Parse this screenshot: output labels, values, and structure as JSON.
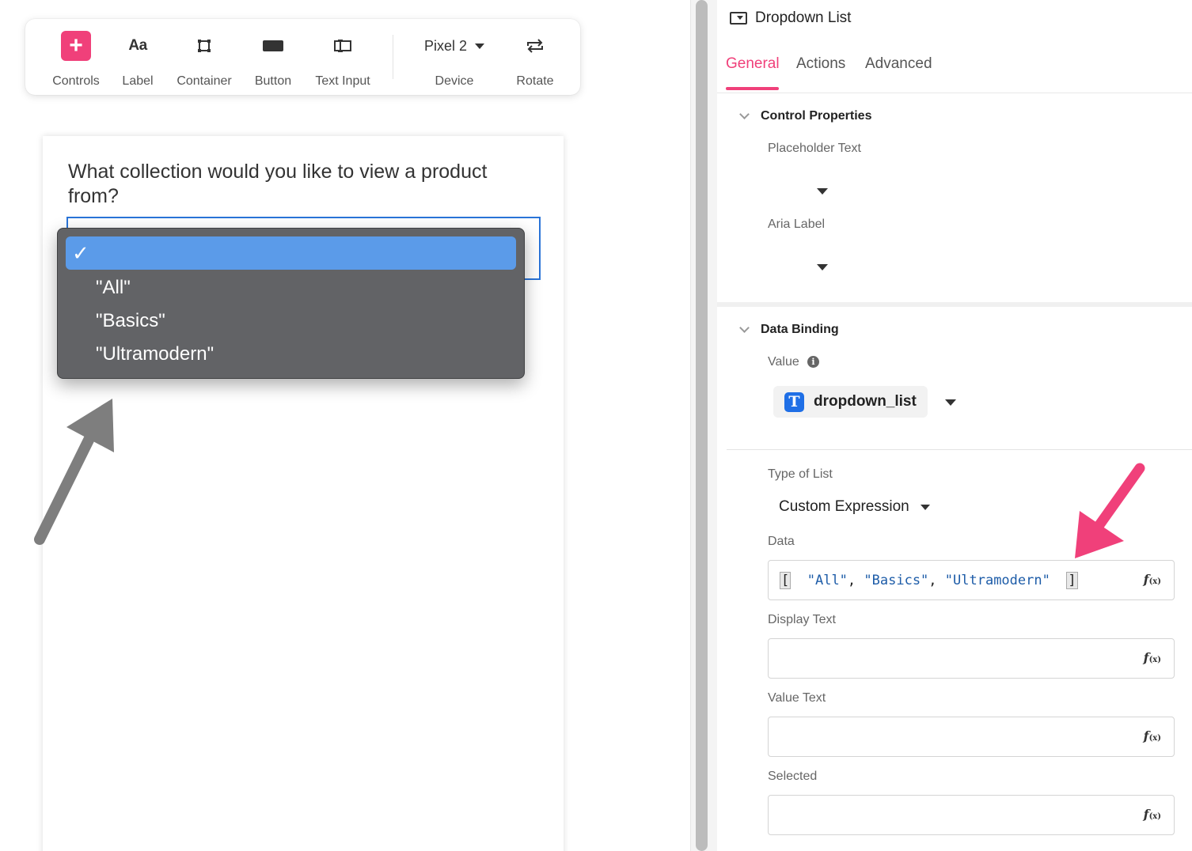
{
  "toolbar": {
    "controls_label": "Controls",
    "label_label": "Label",
    "label_icon_text": "Aa",
    "container_label": "Container",
    "button_label": "Button",
    "text_input_label": "Text Input",
    "device_value": "Pixel 2",
    "device_label": "Device",
    "rotate_label": "Rotate"
  },
  "canvas": {
    "question": "What collection would you like to view a product from?",
    "dropdown_options": [
      {
        "label": "",
        "selected": true
      },
      {
        "label": "\"All\"",
        "selected": false
      },
      {
        "label": "\"Basics\"",
        "selected": false
      },
      {
        "label": "\"Ultramodern\"",
        "selected": false
      }
    ],
    "check_glyph": "✓"
  },
  "panel": {
    "title": "Dropdown List",
    "tabs": [
      {
        "label": "General",
        "active": true
      },
      {
        "label": "Actions",
        "active": false
      },
      {
        "label": "Advanced",
        "active": false
      }
    ],
    "control_properties": {
      "heading": "Control Properties",
      "placeholder_label": "Placeholder Text",
      "aria_label": "Aria Label"
    },
    "data_binding": {
      "heading": "Data Binding",
      "value_label": "Value",
      "info_glyph": "i",
      "variable_badge": "T",
      "variable_name": "dropdown_list",
      "type_of_list_label": "Type of List",
      "type_of_list_value": "Custom Expression",
      "data_label": "Data",
      "data_expression": {
        "open_bracket": "[",
        "items": [
          "\"All\"",
          "\"Basics\"",
          "\"Ultramodern\""
        ],
        "separator": ", ",
        "close_bracket": "]"
      },
      "display_text_label": "Display Text",
      "value_text_label": "Value Text",
      "selected_label": "Selected",
      "fx_glyph": "f",
      "fx_sub": "(x)"
    }
  },
  "colors": {
    "accent_pink": "#f0407a",
    "selection_blue": "#5b9be9",
    "focus_blue": "#2a74d8",
    "popup_gray": "#626366",
    "variable_blue": "#1f6fe6"
  }
}
